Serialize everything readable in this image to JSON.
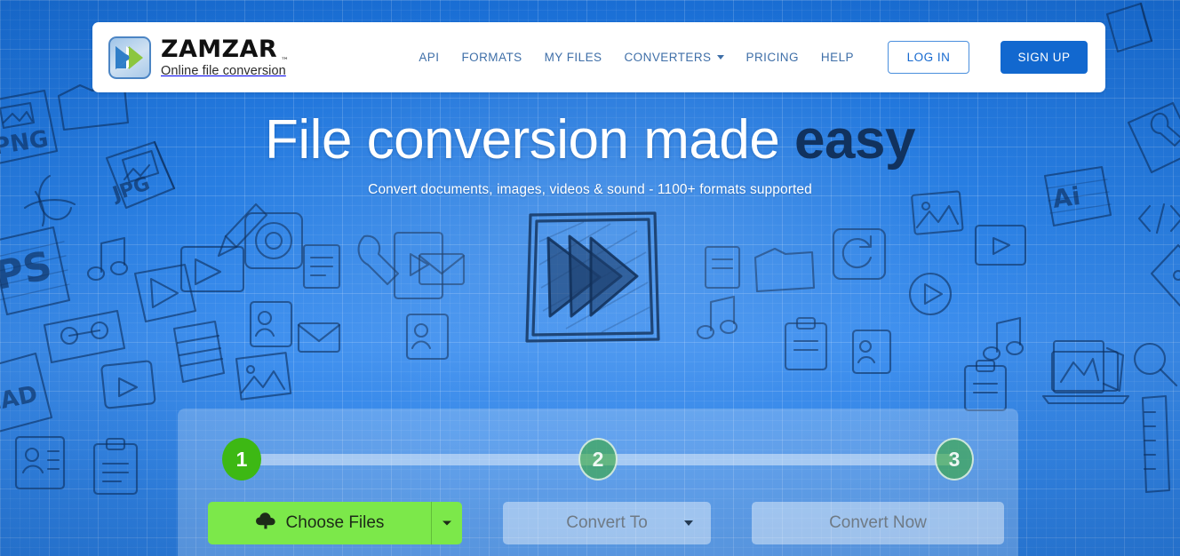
{
  "brand": {
    "name": "ZAMZAR",
    "trademark": "™",
    "tagline": "Online file conversion",
    "logo_icon": "double-chevron-icon",
    "logo_colors": {
      "chevron_blue": "#2f7ec8",
      "chevron_green": "#8cc63f"
    }
  },
  "nav": {
    "items": [
      {
        "label": "API",
        "name": "nav-item-api",
        "has_caret": false
      },
      {
        "label": "FORMATS",
        "name": "nav-item-formats",
        "has_caret": false
      },
      {
        "label": "MY FILES",
        "name": "nav-item-my-files",
        "has_caret": false
      },
      {
        "label": "CONVERTERS",
        "name": "nav-item-converters",
        "has_caret": true
      },
      {
        "label": "PRICING",
        "name": "nav-item-pricing",
        "has_caret": false
      },
      {
        "label": "HELP",
        "name": "nav-item-help",
        "has_caret": false
      }
    ],
    "login_label": "LOG IN",
    "signup_label": "SIGN UP",
    "link_color": "#3f6fa8",
    "signup_bg": "#1268cf"
  },
  "hero": {
    "headline_plain": "File conversion made ",
    "headline_accent": "easy",
    "subtitle": "Convert documents, images, videos & sound - 1100+ formats supported",
    "illustration": "fast-forward-sketch-icon",
    "headline_color": "#ffffff",
    "accent_color": "#11325e"
  },
  "converter": {
    "steps": [
      {
        "number": "1",
        "state": "active",
        "name": "step-indicator-1"
      },
      {
        "number": "2",
        "state": "inactive",
        "name": "step-indicator-2"
      },
      {
        "number": "3",
        "state": "inactive",
        "name": "step-indicator-3"
      }
    ],
    "choose_files_label": "Choose Files",
    "choose_files_icon": "cloud-upload-icon",
    "convert_to_label": "Convert To",
    "convert_now_label": "Convert Now",
    "choose_files_color": "#7ce84a",
    "disabled_text_color": "#6f7a85"
  },
  "background": {
    "theme": "blueprint-grid",
    "base_color": "#2a80e4",
    "sketch_labels": [
      "PNG",
      "JPG",
      "PS",
      "CAD",
      "Ai"
    ]
  }
}
